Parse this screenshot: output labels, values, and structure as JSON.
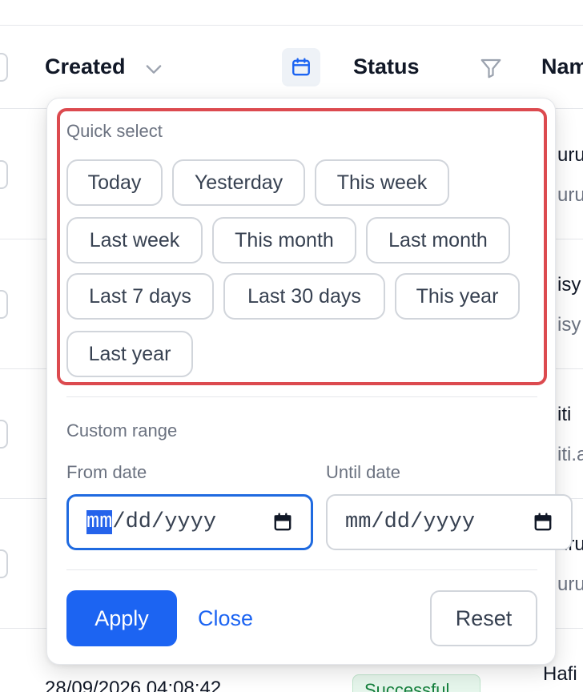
{
  "table": {
    "headers": {
      "created": "Created",
      "status": "Status",
      "name": "Nam"
    },
    "rows": [
      {
        "name": "uru",
        "sub": "uru"
      },
      {
        "name": "isy",
        "sub": "isy"
      },
      {
        "name": "iti ",
        "sub": "iti.a"
      },
      {
        "name": "uru",
        "sub": "uru"
      }
    ],
    "bottom_row": {
      "date": "28/09/2026 04:08:42",
      "status": "Successful",
      "name": "Hafi"
    }
  },
  "popover": {
    "quick_select_label": "Quick select",
    "chips": [
      "Today",
      "Yesterday",
      "This week",
      "Last week",
      "This month",
      "Last month",
      "Last 7 days",
      "Last 30 days",
      "This year",
      "Last year"
    ],
    "custom_range_label": "Custom range",
    "from_label": "From date",
    "until_label": "Until date",
    "from_value": {
      "segment": "mm",
      "rest": "/dd/yyyy"
    },
    "until_value": "mm/dd/yyyy",
    "apply_label": "Apply",
    "close_label": "Close",
    "reset_label": "Reset"
  },
  "colors": {
    "accent": "#1c64f2",
    "highlight_border": "#dc4a4f",
    "success": "#15803d"
  },
  "icons": {
    "sort": "chevron-down-icon",
    "calendar": "calendar-icon",
    "filter": "filter-icon"
  }
}
